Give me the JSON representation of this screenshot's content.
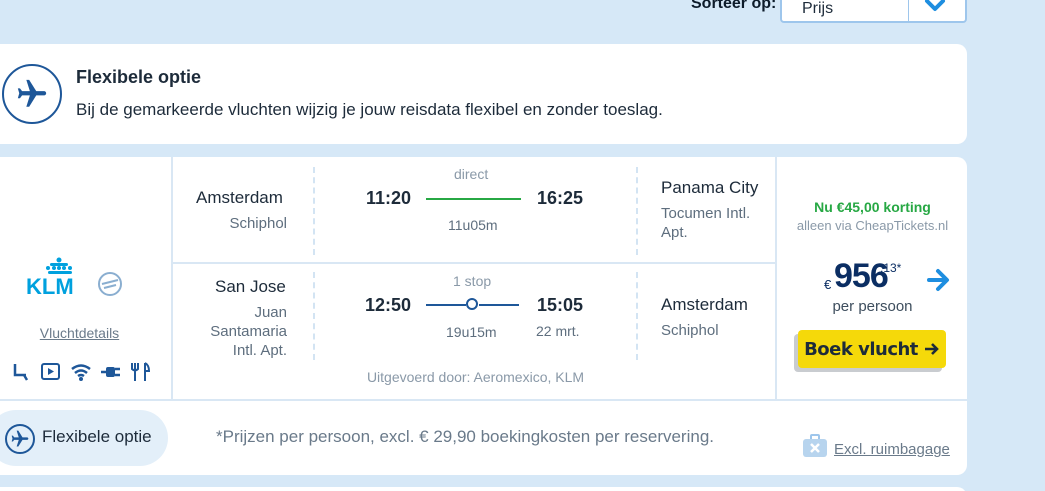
{
  "sort": {
    "label": "Sorteer op:",
    "value": "Prijs"
  },
  "banner": {
    "title": "Flexibele optie",
    "description": "Bij de gemarkeerde vluchten wijzig je jouw reisdata flexibel en zonder toeslag."
  },
  "airline": {
    "logo_text": "KLM",
    "details_link": "Vluchtdetails"
  },
  "outbound": {
    "from_city": "Amsterdam",
    "from_airport": "Schiphol",
    "depart": "11:20",
    "arrive": "16:25",
    "stops": "direct",
    "duration": "11u05m",
    "to_city": "Panama City",
    "to_airport": "Tocumen Intl. Apt."
  },
  "inbound": {
    "from_city": "San Jose",
    "from_airport": "Juan Santamaria Intl. Apt.",
    "depart": "12:50",
    "arrive": "15:05",
    "stops": "1 stop",
    "duration": "19u15m",
    "arrive_date": "22 mrt.",
    "to_city": "Amsterdam",
    "to_airport": "Schiphol"
  },
  "operated_by": "Uitgevoerd door: Aeromexico, KLM",
  "price": {
    "discount": "Nu €45,00 korting",
    "discount_sub": "alleen via CheapTickets.nl",
    "currency": "€",
    "amount": "956",
    "cents": ",13*",
    "per_person": "per persoon",
    "book_label": "Boek vlucht"
  },
  "footer": {
    "flex_label": "Flexibele optie",
    "footnote": "*Prijzen per persoon, excl. € 29,90 boekingkosten per reservering.",
    "baggage": "Excl. ruimbagage"
  },
  "colors": {
    "accent": "#1e5799",
    "green": "#27a844",
    "button": "#f5d90a",
    "price": "#0b2e63"
  }
}
